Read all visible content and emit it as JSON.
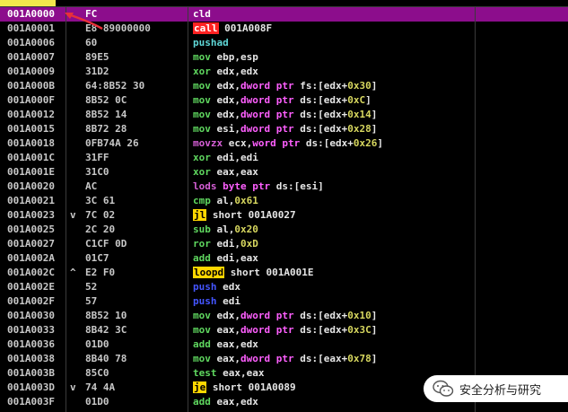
{
  "rows": [
    {
      "addr": "001A0000",
      "sym": "",
      "hex": "FC",
      "mn": "cld",
      "mc": "m-white",
      "ops": "",
      "sel": true
    },
    {
      "addr": "001A0001",
      "sym": "",
      "hex": "E8 89000000",
      "mn": "call",
      "mc": "m-call",
      "ops": "001A008F"
    },
    {
      "addr": "001A0006",
      "sym": "",
      "hex": "60",
      "mn": "pushad",
      "mc": "m-cyan",
      "ops": ""
    },
    {
      "addr": "001A0007",
      "sym": "",
      "hex": "89E5",
      "mn": "mov",
      "mc": "m-green",
      "ops": "ebp,esp"
    },
    {
      "addr": "001A0009",
      "sym": "",
      "hex": "31D2",
      "mn": "xor",
      "mc": "m-green",
      "ops": "edx,edx"
    },
    {
      "addr": "001A000B",
      "sym": "",
      "hex": "64:8B52 30",
      "mn": "mov",
      "mc": "m-green",
      "ops": "edx,dword ptr fs:[edx+0x30]"
    },
    {
      "addr": "001A000F",
      "sym": "",
      "hex": "8B52 0C",
      "mn": "mov",
      "mc": "m-green",
      "ops": "edx,dword ptr ds:[edx+0xC]"
    },
    {
      "addr": "001A0012",
      "sym": "",
      "hex": "8B52 14",
      "mn": "mov",
      "mc": "m-green",
      "ops": "edx,dword ptr ds:[edx+0x14]"
    },
    {
      "addr": "001A0015",
      "sym": "",
      "hex": "8B72 28",
      "mn": "mov",
      "mc": "m-green",
      "ops": "esi,dword ptr ds:[edx+0x28]"
    },
    {
      "addr": "001A0018",
      "sym": "",
      "hex": "0FB74A 26",
      "mn": "movzx",
      "mc": "m-magenta",
      "ops": "ecx,word ptr ds:[edx+0x26]"
    },
    {
      "addr": "001A001C",
      "sym": "",
      "hex": "31FF",
      "mn": "xor",
      "mc": "m-green",
      "ops": "edi,edi"
    },
    {
      "addr": "001A001E",
      "sym": "",
      "hex": "31C0",
      "mn": "xor",
      "mc": "m-green",
      "ops": "eax,eax"
    },
    {
      "addr": "001A0020",
      "sym": "",
      "hex": "AC",
      "mn": "lods",
      "mc": "m-magenta",
      "ops": "byte ptr ds:[esi]"
    },
    {
      "addr": "001A0021",
      "sym": "",
      "hex": "3C 61",
      "mn": "cmp",
      "mc": "m-green",
      "ops": "al,0x61"
    },
    {
      "addr": "001A0023",
      "sym": "v",
      "hex": "7C 02",
      "mn": "jl",
      "mc": "m-jmp",
      "ops": "short 001A0027"
    },
    {
      "addr": "001A0025",
      "sym": "",
      "hex": "2C 20",
      "mn": "sub",
      "mc": "m-green",
      "ops": "al,0x20"
    },
    {
      "addr": "001A0027",
      "sym": "",
      "hex": "C1CF 0D",
      "mn": "ror",
      "mc": "m-green",
      "ops": "edi,0xD"
    },
    {
      "addr": "001A002A",
      "sym": "",
      "hex": "01C7",
      "mn": "add",
      "mc": "m-green",
      "ops": "edi,eax"
    },
    {
      "addr": "001A002C",
      "sym": "^",
      "hex": "E2 F0",
      "mn": "loopd",
      "mc": "m-jmp",
      "ops": "short 001A001E"
    },
    {
      "addr": "001A002E",
      "sym": "",
      "hex": "52",
      "mn": "push",
      "mc": "m-blue",
      "ops": "edx"
    },
    {
      "addr": "001A002F",
      "sym": "",
      "hex": "57",
      "mn": "push",
      "mc": "m-blue",
      "ops": "edi"
    },
    {
      "addr": "001A0030",
      "sym": "",
      "hex": "8B52 10",
      "mn": "mov",
      "mc": "m-green",
      "ops": "edx,dword ptr ds:[edx+0x10]"
    },
    {
      "addr": "001A0033",
      "sym": "",
      "hex": "8B42 3C",
      "mn": "mov",
      "mc": "m-green",
      "ops": "eax,dword ptr ds:[edx+0x3C]"
    },
    {
      "addr": "001A0036",
      "sym": "",
      "hex": "01D0",
      "mn": "add",
      "mc": "m-green",
      "ops": "eax,edx"
    },
    {
      "addr": "001A0038",
      "sym": "",
      "hex": "8B40 78",
      "mn": "mov",
      "mc": "m-green",
      "ops": "eax,dword ptr ds:[eax+0x78]"
    },
    {
      "addr": "001A003B",
      "sym": "",
      "hex": "85C0",
      "mn": "test",
      "mc": "m-green",
      "ops": "eax,eax"
    },
    {
      "addr": "001A003D",
      "sym": "v",
      "hex": "74 4A",
      "mn": "je",
      "mc": "m-jmp",
      "ops": "short 001A0089"
    },
    {
      "addr": "001A003F",
      "sym": "",
      "hex": "01D0",
      "mn": "add",
      "mc": "m-green",
      "ops": "eax,edx"
    }
  ],
  "watermark": {
    "text": "安全分析与研究"
  },
  "colors": {
    "selection": "#8c0d8c",
    "jump_highlight": "#ffd700",
    "call_highlight": "#ff2222",
    "arrow": "#e8303a"
  }
}
